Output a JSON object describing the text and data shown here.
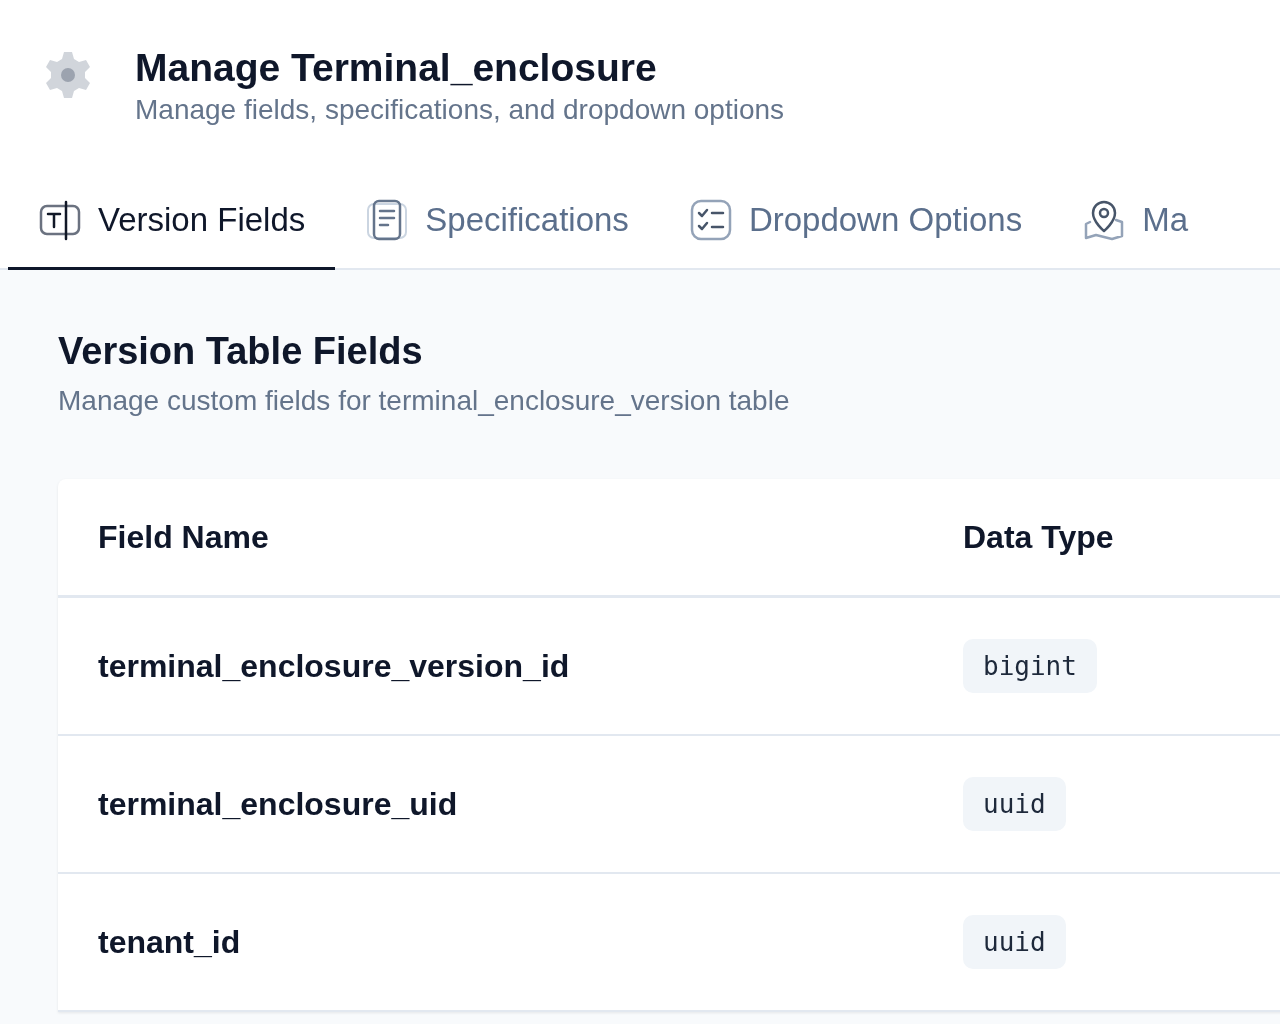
{
  "header": {
    "title": "Manage Terminal_enclosure",
    "subtitle": "Manage fields, specifications, and dropdown options"
  },
  "tabs": [
    {
      "label": "Version Fields",
      "kind": "text",
      "selected": true
    },
    {
      "label": "Specifications",
      "kind": "document",
      "selected": false
    },
    {
      "label": "Dropdown Options",
      "kind": "checklist",
      "selected": false
    },
    {
      "label": "Ma",
      "kind": "pin",
      "selected": false
    }
  ],
  "section": {
    "title": "Version Table Fields",
    "subtitle": "Manage custom fields for terminal_enclosure_version table"
  },
  "table": {
    "columns": [
      "Field Name",
      "Data Type"
    ],
    "rows": [
      {
        "field_name": "terminal_enclosure_version_id",
        "data_type": "bigint"
      },
      {
        "field_name": "terminal_enclosure_uid",
        "data_type": "uuid"
      },
      {
        "field_name": "tenant_id",
        "data_type": "uuid"
      }
    ]
  }
}
